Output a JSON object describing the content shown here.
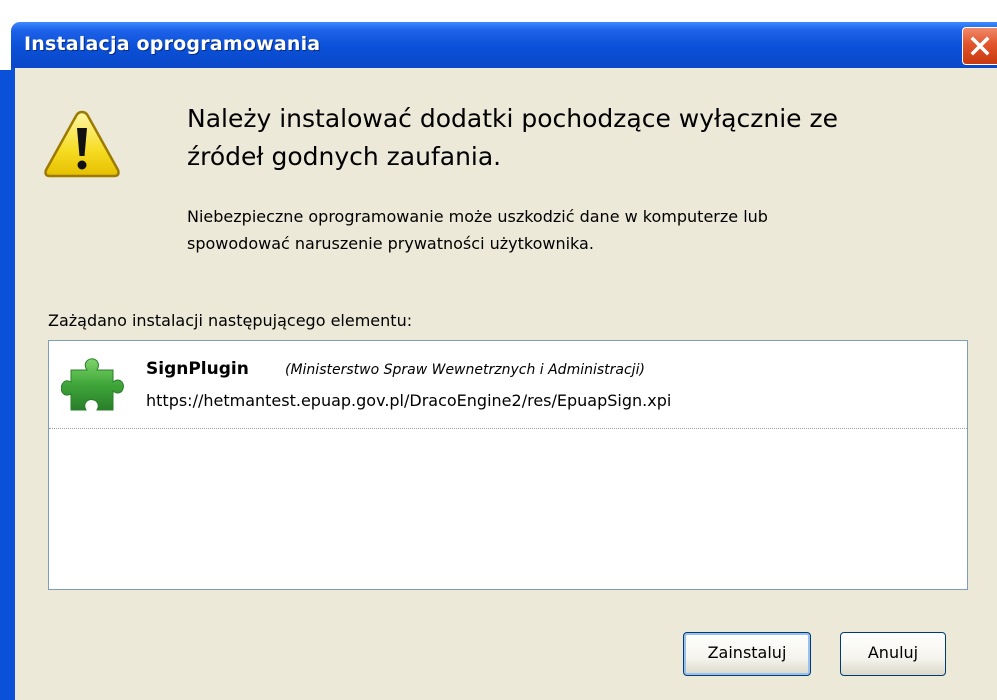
{
  "window": {
    "title": "Instalacja oprogramowania",
    "close_icon": "close-icon"
  },
  "warning": {
    "icon": "warning-icon",
    "headline_line1": "Należy instalować dodatki pochodzące wyłącznie ze",
    "headline_line2": "źródeł godnych zaufania.",
    "description_line1": "Niebezpieczne oprogramowanie może uszkodzić dane w komputerze lub",
    "description_line2": "spowodować naruszenie prywatności użytkownika."
  },
  "request": {
    "label": "Zażądano instalacji następującego elementu:",
    "items": [
      {
        "icon": "puzzle-icon",
        "name": "SignPlugin",
        "author": "(Ministerstwo Spraw Wewnetrznych i Administracji)",
        "url": "https://hetmantest.epuap.gov.pl/DracoEngine2/res/EpuapSign.xpi"
      }
    ]
  },
  "buttons": {
    "install": "Zainstaluj",
    "cancel": "Anuluj"
  },
  "colors": {
    "titlebar": "#0a50d8",
    "dialog_bg": "#ece9d8",
    "close_button": "#e2542c",
    "plugin_green": "#3fa63a"
  }
}
